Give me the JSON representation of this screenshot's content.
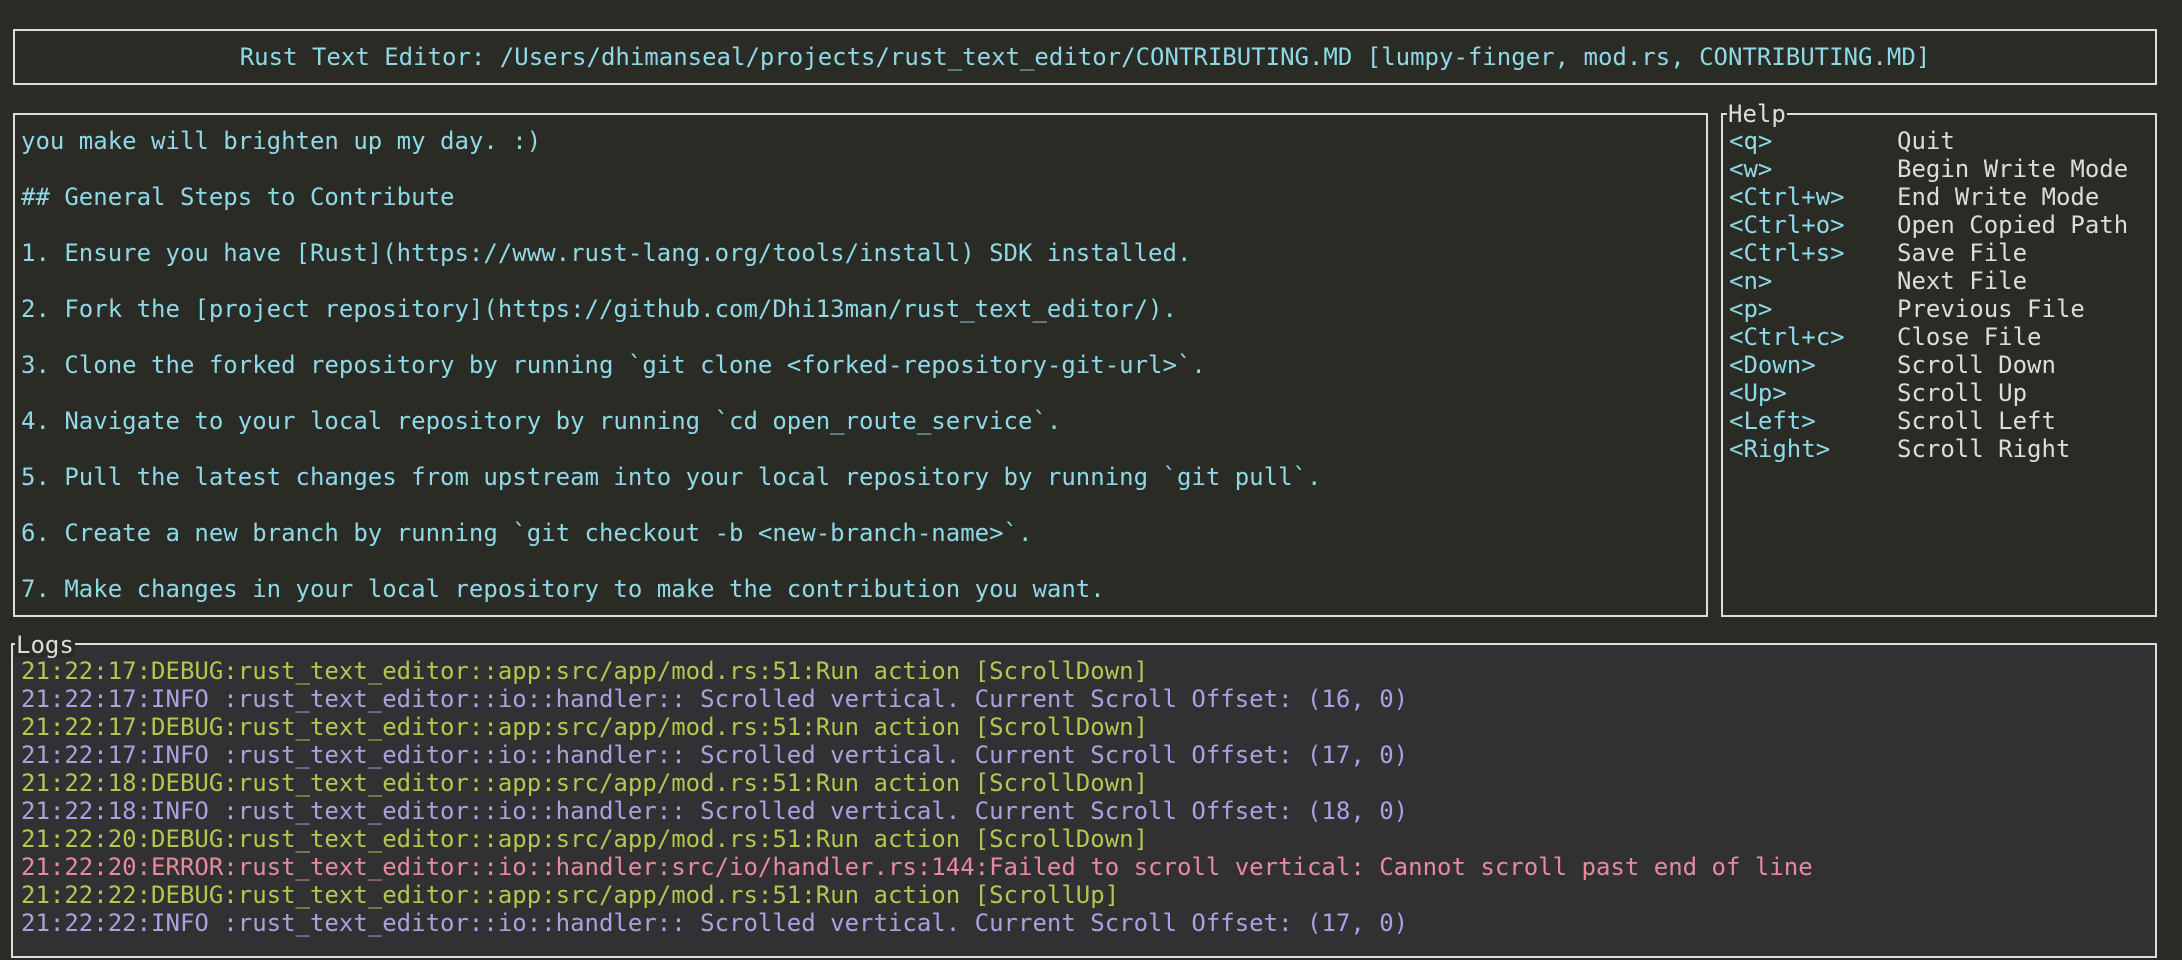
{
  "window": {
    "title": "Rust Text Editor: /Users/dhimanseal/projects/rust_text_editor/CONTRIBUTING.MD [lumpy-finger, mod.rs, CONTRIBUTING.MD]"
  },
  "editor": {
    "lines": [
      "you make will brighten up my day. :)",
      "",
      "## General Steps to Contribute",
      "",
      "1. Ensure you have [Rust](https://www.rust-lang.org/tools/install) SDK installed.",
      "",
      "2. Fork the [project repository](https://github.com/Dhi13man/rust_text_editor/).",
      "",
      "3. Clone the forked repository by running `git clone <forked-repository-git-url>`.",
      "",
      "4. Navigate to your local repository by running `cd open_route_service`.",
      "",
      "5. Pull the latest changes from upstream into your local repository by running `git pull`.",
      "",
      "6. Create a new branch by running `git checkout -b <new-branch-name>`.",
      "",
      "7. Make changes in your local repository to make the contribution you want."
    ]
  },
  "help": {
    "title": "Help",
    "rows": [
      {
        "key": "<q>",
        "desc": "Quit"
      },
      {
        "key": "<w>",
        "desc": "Begin Write Mode"
      },
      {
        "key": "<Ctrl+w>",
        "desc": "End Write Mode"
      },
      {
        "key": "<Ctrl+o>",
        "desc": "Open Copied Path"
      },
      {
        "key": "<Ctrl+s>",
        "desc": "Save File"
      },
      {
        "key": "<n>",
        "desc": "Next File"
      },
      {
        "key": "<p>",
        "desc": "Previous File"
      },
      {
        "key": "<Ctrl+c>",
        "desc": "Close File"
      },
      {
        "key": "<Down>",
        "desc": "Scroll Down"
      },
      {
        "key": "<Up>",
        "desc": "Scroll Up"
      },
      {
        "key": "<Left>",
        "desc": "Scroll Left"
      },
      {
        "key": "<Right>",
        "desc": "Scroll Right"
      }
    ]
  },
  "logs": {
    "title": "Logs",
    "entries": [
      {
        "level": "debug",
        "text": "21:22:17:DEBUG:rust_text_editor::app:src/app/mod.rs:51:Run action [ScrollDown]"
      },
      {
        "level": "info",
        "text": "21:22:17:INFO :rust_text_editor::io::handler:: Scrolled vertical. Current Scroll Offset: (16, 0)"
      },
      {
        "level": "debug",
        "text": "21:22:17:DEBUG:rust_text_editor::app:src/app/mod.rs:51:Run action [ScrollDown]"
      },
      {
        "level": "info",
        "text": "21:22:17:INFO :rust_text_editor::io::handler:: Scrolled vertical. Current Scroll Offset: (17, 0)"
      },
      {
        "level": "debug",
        "text": "21:22:18:DEBUG:rust_text_editor::app:src/app/mod.rs:51:Run action [ScrollDown]"
      },
      {
        "level": "info",
        "text": "21:22:18:INFO :rust_text_editor::io::handler:: Scrolled vertical. Current Scroll Offset: (18, 0)"
      },
      {
        "level": "debug",
        "text": "21:22:20:DEBUG:rust_text_editor::app:src/app/mod.rs:51:Run action [ScrollDown]"
      },
      {
        "level": "error",
        "text": "21:22:20:ERROR:rust_text_editor::io::handler:src/io/handler.rs:144:Failed to scroll vertical: Cannot scroll past end of line"
      },
      {
        "level": "debug",
        "text": "21:22:22:DEBUG:rust_text_editor::app:src/app/mod.rs:51:Run action [ScrollUp]"
      },
      {
        "level": "info",
        "text": "21:22:22:INFO :rust_text_editor::io::handler:: Scrolled vertical. Current Scroll Offset: (17, 0)"
      }
    ]
  },
  "colors": {
    "background": "#2b2b26",
    "border": "#dcdcdc",
    "text_cyan": "#8fd9e6",
    "log_debug": "#b5c64e",
    "log_info": "#a7a3e0",
    "log_error": "#e78a9c"
  }
}
